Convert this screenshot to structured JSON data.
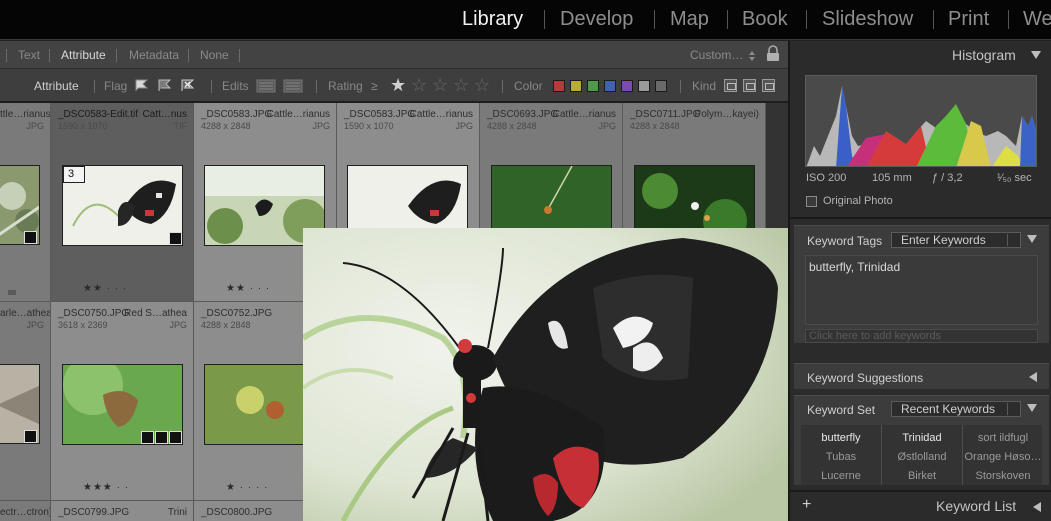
{
  "modules": [
    {
      "label": "Library",
      "active": true
    },
    {
      "label": "Develop",
      "active": false
    },
    {
      "label": "Map",
      "active": false
    },
    {
      "label": "Book",
      "active": false
    },
    {
      "label": "Slideshow",
      "active": false
    },
    {
      "label": "Print",
      "active": false
    },
    {
      "label": "We",
      "active": false
    }
  ],
  "filter_tabs": {
    "text": "Text",
    "attribute": "Attribute",
    "metadata": "Metadata",
    "none": "None",
    "preset": "Custom…"
  },
  "attribute_bar": {
    "title": "Attribute",
    "flag": "Flag",
    "edits": "Edits",
    "rating": "Rating",
    "rating_op": "≥",
    "color": "Color",
    "kind": "Kind",
    "color_swatches": [
      "#b33b3b",
      "#b7ad35",
      "#4f9a4a",
      "#3f63b2",
      "#7a4bb0",
      "#9a9a9a",
      "#6a6a6a"
    ]
  },
  "grid": {
    "row1": [
      {
        "name": "ttle…rianus",
        "meta": "",
        "dims": "",
        "ext": "JPG",
        "stars": ""
      },
      {
        "name": "_DSC0583-Edit.tif",
        "meta": "Catt…nus",
        "dims": "1590 x 1070",
        "ext": "TIF",
        "stars": "★★ · · ·",
        "index": "3"
      },
      {
        "name": "_DSC0583.JPG",
        "meta": "Cattle…rianus",
        "dims": "4288 x 2848",
        "ext": "JPG",
        "stars": "★★ · · ·"
      },
      {
        "name": "_DSC0583.JPG",
        "meta": "Cattle…rianus",
        "dims": "1590 x 1070",
        "ext": "JPG",
        "stars": ""
      },
      {
        "name": "_DSC0693.JPG",
        "meta": "Cattle…rianus",
        "dims": "4288 x 2848",
        "ext": "JPG",
        "stars": ""
      },
      {
        "name": "_DSC0711.JPG",
        "meta": "Polym…kayei)",
        "dims": "4288 x 2848",
        "ext": "JPG",
        "stars": ""
      }
    ],
    "row2": [
      {
        "name": "arle…athea",
        "meta": "",
        "dims": "",
        "ext": "JPG",
        "stars": ""
      },
      {
        "name": "_DSC0750.JPG",
        "meta": "Red S…athea",
        "dims": "3618 x 2369",
        "ext": "JPG",
        "stars": "★★★ · ·"
      },
      {
        "name": "_DSC0752.JPG",
        "meta": "",
        "dims": "4288 x 2848",
        "ext": "",
        "stars": "★ · · · ·"
      }
    ],
    "row3": [
      {
        "name": "ectr…ctron)",
        "meta": ""
      },
      {
        "name": "_DSC0799.JPG",
        "meta": "Trini"
      },
      {
        "name": "_DSC0800.JPG",
        "meta": ""
      }
    ]
  },
  "histogram": {
    "title": "Histogram",
    "iso": "ISO 200",
    "focal": "105 mm",
    "aperture": "ƒ / 3,2",
    "shutter": "¹⁄₅₀ sec",
    "original_photo": "Original Photo"
  },
  "keyword_tags": {
    "title": "Keyword Tags",
    "mode": "Enter Keywords",
    "keywords": "butterfly, Trinidad",
    "add_placeholder": "Click here to add keywords"
  },
  "keyword_suggestions": {
    "title": "Keyword Suggestions"
  },
  "keyword_set": {
    "title": "Keyword Set",
    "set": "Recent Keywords",
    "keywords": [
      [
        "butterfly",
        "Trinidad",
        "sort ildfugl"
      ],
      [
        "Tubas",
        "Østlolland",
        "Orange Høso…"
      ],
      [
        "Lucerne",
        "Birket",
        "Storskoven"
      ]
    ]
  },
  "keyword_list": {
    "title": "Keyword List",
    "add": "+"
  }
}
